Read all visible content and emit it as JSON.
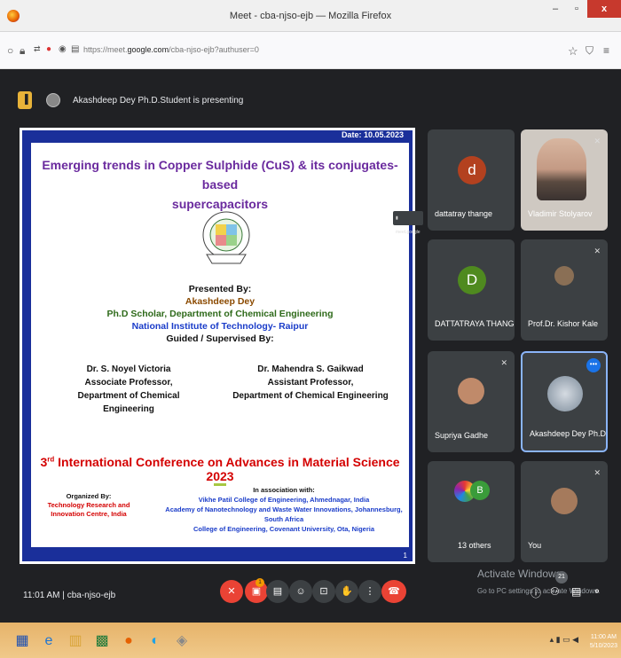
{
  "window": {
    "title": "Meet - cba-njso-ejb — Mozilla Firefox",
    "min": "–",
    "max": "▫",
    "close": "x"
  },
  "urlbar": {
    "url_prefix": "https://meet.",
    "url_domain": "google.com",
    "url_path": "/cba-njso-ejb?authuser=0"
  },
  "meet": {
    "presenting_text": "Akashdeep Dey Ph.D.Student is presenting",
    "popup_text": "meet.google",
    "time": "11:01 AM",
    "separator": "|",
    "meeting_code": "cba-njso-ejb",
    "activate_title": "Activate Windows",
    "activate_sub": "Go to PC settings to activate Windows.",
    "people_count": "21",
    "badge_count": "1"
  },
  "slide": {
    "date": "Date: 10.05.2023",
    "title_line1": "Emerging trends in Copper Sulphide (CuS) & its conjugates-based",
    "title_line2": "supercapacitors",
    "presented_by": "Presented By:",
    "presenter": "Akashdeep Dey",
    "scholar": "Ph.D Scholar, Department of Chemical Engineering",
    "institute": "National Institute of Technology- Raipur",
    "guided": "Guided / Supervised By:",
    "guide1_name": "Dr. S. Noyel Victoria",
    "guide1_role": "Associate Professor,",
    "guide1_dept": "Department of Chemical Engineering",
    "guide2_name": "Dr. Mahendra S. Gaikwad",
    "guide2_role": "Assistant Professor,",
    "guide2_dept": "Department of Chemical Engineering",
    "conf_num": "3",
    "conf_sup": "rd",
    "conf_text": " International Conference on Advances in Material Science 2023",
    "organized_by": "Organized By:",
    "organizer": "Technology Research and Innovation Centre, India",
    "assoc": "In association with:",
    "assoc1": "Vikhe Patil College of Engineering, Ahmednagar, India",
    "assoc2": "Academy of Nanotechnology and Waste Water Innovations, Johannesburg, South Africa",
    "assoc3": "College of Engineering, Covenant University, Ota, Nigeria",
    "page": "1"
  },
  "tiles": [
    {
      "name": "dattatray thange",
      "initial": "d",
      "color": "#b3411f"
    },
    {
      "name": "Vladimir Stolyarov"
    },
    {
      "name": "DATTATRAYA THANGE",
      "initial": "D",
      "color": "#4f8a1f"
    },
    {
      "name": "Prof.Dr. Kishor Kale"
    },
    {
      "name": "Supriya Gadhe"
    },
    {
      "name": "Akashdeep Dey Ph.D.S..."
    },
    {
      "name": "13 others",
      "initial": "B",
      "color": "#3a9c3a"
    },
    {
      "name": "You"
    }
  ],
  "taskbar": {
    "clock_time": "11:00 AM",
    "clock_date": "5/10/2023"
  }
}
